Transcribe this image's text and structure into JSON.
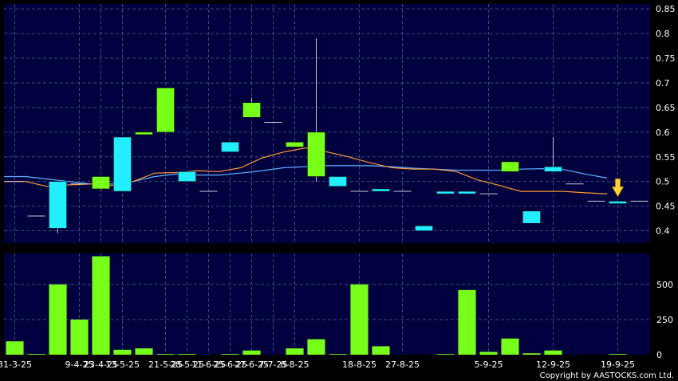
{
  "chart_data": {
    "type": "candlestick",
    "copyright": "Copyright by AASTOCKS.com Ltd.",
    "colors": {
      "background": "#00003f",
      "frame": "#000000",
      "grid": "#3a4a8a",
      "up": "#77ff1a",
      "down": "#22eeff",
      "ma_short": "#5fb2ff",
      "ma_long": "#ff9a2e",
      "marker": "#ffd23a",
      "text": "#ffffff"
    },
    "price_axis": {
      "ylim": [
        0.375,
        0.86
      ],
      "ticks": [
        "0.85",
        "0.8",
        "0.75",
        "0.7",
        "0.65",
        "0.6",
        "0.55",
        "0.5",
        "0.45",
        "0.4"
      ],
      "tick_values": [
        0.85,
        0.8,
        0.75,
        0.7,
        0.65,
        0.6,
        0.55,
        0.5,
        0.45,
        0.4
      ]
    },
    "volume_axis": {
      "ylim": [
        0,
        720
      ],
      "ticks": [
        "500",
        "250",
        "0"
      ],
      "tick_values": [
        500,
        250,
        0
      ]
    },
    "x_labels": [
      {
        "label": "31-3-25",
        "index": 0
      },
      {
        "label": "9-4-25",
        "index": 3
      },
      {
        "label": "23-4-25",
        "index": 4
      },
      {
        "label": "13-5-25",
        "index": 5
      },
      {
        "label": "21-5-25",
        "index": 7
      },
      {
        "label": "28-5-25",
        "index": 8
      },
      {
        "label": "11-6-25",
        "index": 9
      },
      {
        "label": "25-6-25",
        "index": 10
      },
      {
        "label": "27-6-25",
        "index": 11
      },
      {
        "label": "7-7-25",
        "index": 12
      },
      {
        "label": "8-8-25",
        "index": 13
      },
      {
        "label": "18-8-25",
        "index": 16
      },
      {
        "label": "27-8-25",
        "index": 18
      },
      {
        "label": "5-9-25",
        "index": 22
      },
      {
        "label": "12-9-25",
        "index": 25
      },
      {
        "label": "19-9-25",
        "index": 28
      }
    ],
    "candles": [
      {
        "open": 0.5,
        "high": 0.5,
        "low": 0.5,
        "close": 0.5,
        "volume": 95
      },
      {
        "open": 0.43,
        "high": 0.43,
        "low": 0.43,
        "close": 0.43,
        "volume": 5
      },
      {
        "open": 0.5,
        "high": 0.5,
        "low": 0.395,
        "close": 0.405,
        "volume": 500
      },
      {
        "open": 0.495,
        "high": 0.495,
        "low": 0.495,
        "close": 0.495,
        "volume": 250
      },
      {
        "open": 0.485,
        "high": 0.51,
        "low": 0.482,
        "close": 0.51,
        "volume": 700
      },
      {
        "open": 0.59,
        "high": 0.59,
        "low": 0.48,
        "close": 0.48,
        "volume": 35
      },
      {
        "open": 0.595,
        "high": 0.6,
        "low": 0.595,
        "close": 0.6,
        "volume": 45
      },
      {
        "open": 0.6,
        "high": 0.69,
        "low": 0.6,
        "close": 0.69,
        "volume": 5
      },
      {
        "open": 0.52,
        "high": 0.52,
        "low": 0.5,
        "close": 0.5,
        "volume": 5
      },
      {
        "open": 0.48,
        "high": 0.48,
        "low": 0.48,
        "close": 0.48,
        "volume": 0
      },
      {
        "open": 0.58,
        "high": 0.58,
        "low": 0.56,
        "close": 0.56,
        "volume": 5
      },
      {
        "open": 0.63,
        "high": 0.67,
        "low": 0.63,
        "close": 0.66,
        "volume": 30
      },
      {
        "open": 0.62,
        "high": 0.62,
        "low": 0.62,
        "close": 0.62,
        "volume": 0
      },
      {
        "open": 0.57,
        "high": 0.58,
        "low": 0.57,
        "close": 0.58,
        "volume": 45
      },
      {
        "open": 0.51,
        "high": 0.79,
        "low": 0.5,
        "close": 0.6,
        "volume": 110
      },
      {
        "open": 0.51,
        "high": 0.51,
        "low": 0.49,
        "close": 0.49,
        "volume": 5
      },
      {
        "open": 0.48,
        "high": 0.48,
        "low": 0.48,
        "close": 0.48,
        "volume": 500
      },
      {
        "open": 0.485,
        "high": 0.485,
        "low": 0.48,
        "close": 0.48,
        "volume": 60
      },
      {
        "open": 0.48,
        "high": 0.48,
        "low": 0.48,
        "close": 0.48,
        "volume": 0
      },
      {
        "open": 0.41,
        "high": 0.41,
        "low": 0.4,
        "close": 0.4,
        "volume": 0
      },
      {
        "open": 0.48,
        "high": 0.48,
        "low": 0.475,
        "close": 0.475,
        "volume": 5
      },
      {
        "open": 0.48,
        "high": 0.48,
        "low": 0.475,
        "close": 0.475,
        "volume": 460
      },
      {
        "open": 0.475,
        "high": 0.475,
        "low": 0.475,
        "close": 0.475,
        "volume": 20
      },
      {
        "open": 0.52,
        "high": 0.54,
        "low": 0.52,
        "close": 0.54,
        "volume": 115
      },
      {
        "open": 0.44,
        "high": 0.44,
        "low": 0.415,
        "close": 0.415,
        "volume": 10
      },
      {
        "open": 0.53,
        "high": 0.59,
        "low": 0.52,
        "close": 0.52,
        "volume": 30
      },
      {
        "open": 0.495,
        "high": 0.495,
        "low": 0.495,
        "close": 0.495,
        "volume": 0
      },
      {
        "open": 0.46,
        "high": 0.46,
        "low": 0.46,
        "close": 0.46,
        "volume": 0
      },
      {
        "open": 0.46,
        "high": 0.46,
        "low": 0.455,
        "close": 0.455,
        "volume": 5
      },
      {
        "open": 0.46,
        "high": 0.46,
        "low": 0.46,
        "close": 0.46,
        "volume": 0
      }
    ],
    "ma_short": [
      0.51,
      0.51,
      0.505,
      0.5,
      0.495,
      0.495,
      0.5,
      0.51,
      0.515,
      0.513,
      0.513,
      0.517,
      0.522,
      0.528,
      0.53,
      0.532,
      0.532,
      0.532,
      0.53,
      0.527,
      0.525,
      0.523,
      0.523,
      0.523,
      0.525,
      0.526,
      0.524,
      0.515,
      0.507
    ],
    "ma_long": [
      0.5,
      0.5,
      0.49,
      0.493,
      0.495,
      0.492,
      0.5,
      0.517,
      0.518,
      0.522,
      0.52,
      0.528,
      0.548,
      0.56,
      0.568,
      0.56,
      0.55,
      0.538,
      0.528,
      0.525,
      0.525,
      0.52,
      0.503,
      0.492,
      0.48,
      0.48,
      0.48,
      0.477,
      0.475
    ],
    "marker_index": 28
  }
}
